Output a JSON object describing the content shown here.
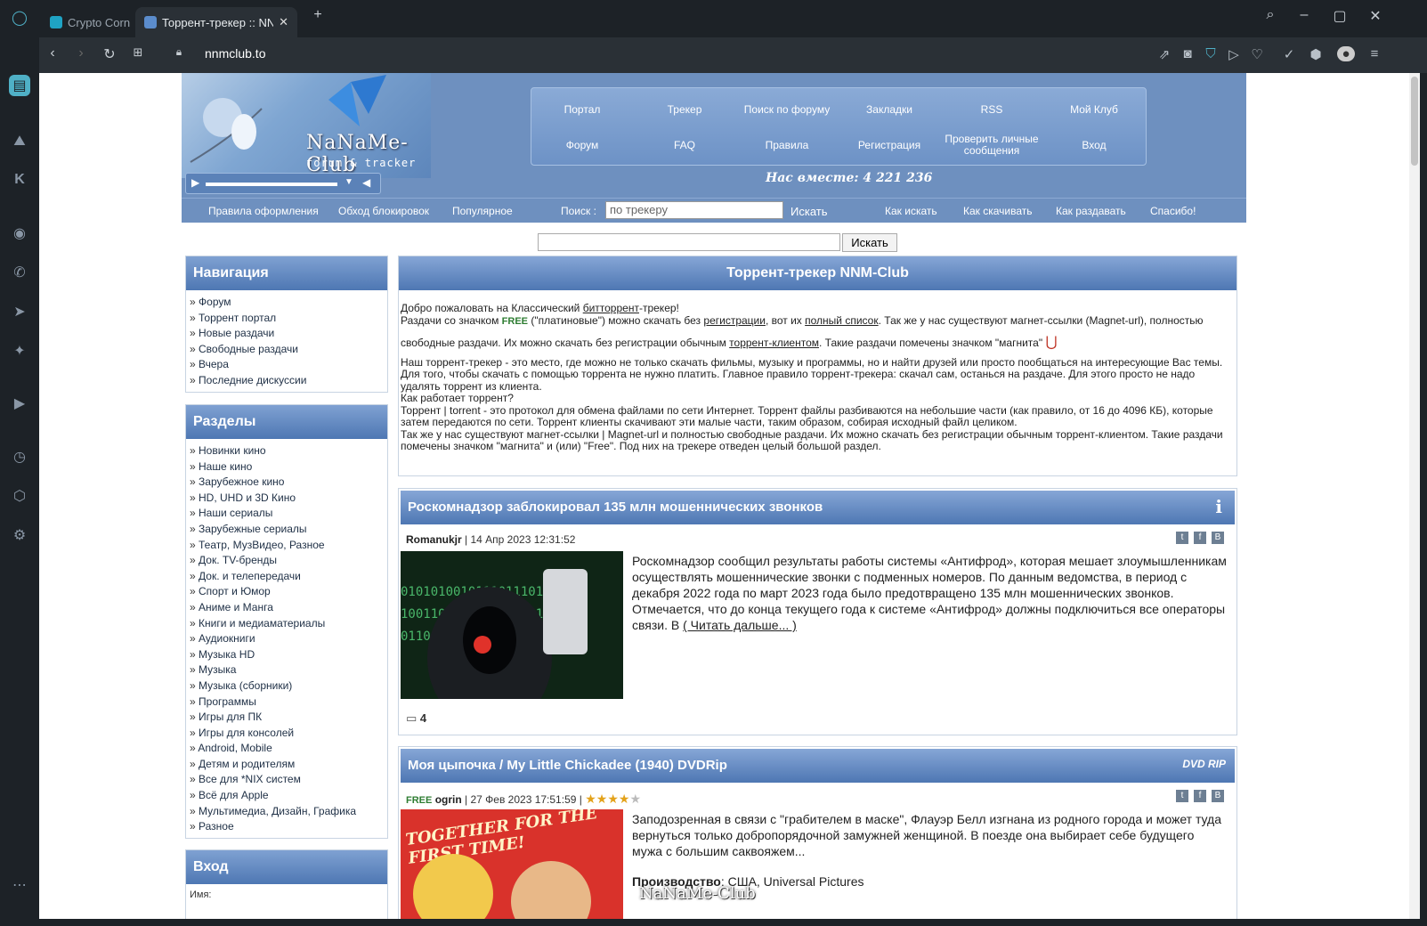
{
  "browser": {
    "tabs": [
      {
        "title": "Crypto Corne",
        "active": false
      },
      {
        "title": "Торрент-трекер :: NNM",
        "active": true
      }
    ],
    "url": "nnmclub.to"
  },
  "banner": {
    "logo_text": "NaNaMe-Club",
    "logo_sub": "forum & tracker",
    "menu_row1": [
      "Портал",
      "Трекер",
      "Поиск по форуму",
      "Закладки",
      "RSS",
      "Мой Клуб"
    ],
    "menu_row2": [
      "Форум",
      "FAQ",
      "Правила",
      "Регистрация",
      "Проверить личные сообщения",
      "Вход"
    ],
    "together": "Нас вместе: 4 221 236"
  },
  "subbar": {
    "links_left": [
      "Правила оформления",
      "Обход блокировок",
      "Популярное"
    ],
    "search_label": "Поиск :",
    "search_placeholder": "по трекеру",
    "search_button": "Искать",
    "links_right": [
      "Как искать",
      "Как скачивать",
      "Как раздавать",
      "Спасибо!"
    ]
  },
  "global_search": {
    "button": "Искать"
  },
  "nav": {
    "title": "Навигация",
    "items": [
      "Форум",
      "Торрент портал",
      "Новые раздачи",
      "Свободные раздачи",
      "Вчера",
      "Последние дискуссии"
    ]
  },
  "sections": {
    "title": "Разделы",
    "items": [
      "Новинки кино",
      "Наше кино",
      "Зарубежное кино",
      "HD, UHD и 3D Кино",
      "Наши сериалы",
      "Зарубежные сериалы",
      "Театр, МузВидео, Разное",
      "Док. TV-бренды",
      "Док. и телепередачи",
      "Спорт и Юмор",
      "Аниме и Манга",
      "Книги и медиаматериалы",
      "Аудиокниги",
      "Музыка HD",
      "Музыка",
      "Музыка (сборники)",
      "Программы",
      "Игры для ПК",
      "Игры для консолей",
      "Android, Mobile",
      "Детям и родителям",
      "Все для *NIX систем",
      "Всё для Apple",
      "Мультимедиа, Дизайн, Графика",
      "Разное"
    ]
  },
  "login": {
    "title": "Вход",
    "name_label": "Имя:"
  },
  "main": {
    "title": "Торрент-трекер NNM-Club",
    "p1a": "Добро пожаловать на Классический ",
    "p1_link": "битторрент",
    "p1b": "-трекер!",
    "p2a": "Раздачи со значком ",
    "free": "FREE",
    "p2b": " (\"платиновые\") можно скачать без ",
    "p2_link1": "регистрации",
    "p2c": ", вот их ",
    "p2_link2": "полный список",
    "p2d": ". Так же у нас существуют магнет-ссылки (Magnet-url), полностью",
    "p3a": "свободные раздачи. Их можно скачать без регистрации обычным ",
    "p3_link": "торрент-клиентом",
    "p3b": ". Такие раздачи помечены значком \"магнита\"",
    "p4": "Наш торрент-трекер - это место, где можно не только скачать фильмы, музыку и программы, но и найти друзей или просто пообщаться на интересующие Вас темы. Для того, чтобы скачать с помощью торрента не нужно платить. Главное правило торрент-трекера: скачал сам, останься на раздаче. Для этого просто не надо удалять торрент из клиента.",
    "p5": "Как работает торрент?",
    "p6": "Торрент | torrent - это протокол для обмена файлами по сети Интернет. Торрент файлы разбиваются на небольшие части (как правило, от 16 до 4096 КБ), которые затем передаются по сети. Торрент клиенты скачивают эти малые части, таким образом, собирая исходный файл целиком.",
    "p7": "Так же у нас существуют магнет-ссылки | Magnet-url и полностью свободные раздачи. Их можно скачать без регистрации обычным торрент-клиентом. Такие раздачи помечены значком \"магнита\" и (или) \"Free\". Под них на трекере отведен целый большой раздел."
  },
  "article1": {
    "title": "Роскомнадзор заблокировал 135 млн мошеннических звонков",
    "author": "Romanukjr",
    "date": "14 Апр 2023 12:31:52",
    "text": "Роскомнадзор сообщил результаты работы системы «Антифрод», которая мешает злоумышленникам осуществлять мошеннические звонки с подменных номеров. По данным ведомства, в период с декабря 2022 года по март 2023 года было предотвращено 135 млн мошеннических звонков.",
    "text2a": "Отмечается, что до конца текущего года к системе «Антифрод» должны подключиться все операторы связи. В ",
    "read_more": "( Читать дальше... )",
    "comments": "4"
  },
  "article2": {
    "title": "Моя цыпочка / My Little Chickadee (1940) DVDRip",
    "free": "FREE",
    "author": "ogrin",
    "date": "27 Фев 2023 17:51:59",
    "rating": 4,
    "badge": "DVD RIP",
    "text": "Заподозренная в связи с \"грабителем в маске\", Флауэр Белл изгнана из родного города и может туда вернуться только добропорядочной замужней женщиной. В поезде она выбирает себе будущего мужа с большим саквояжем...",
    "prod_label": "Производство",
    "prod_value": ": США, Universal Pictures",
    "poster_text": "TOGETHER FOR THE FIRST TIME!",
    "watermark": "NaNaMe-Club"
  },
  "colors": {
    "header_blue": "#6e90bf",
    "title_blue": "#4e77b3",
    "free_green": "#2e7d32",
    "browser_dark": "#1d2227"
  }
}
